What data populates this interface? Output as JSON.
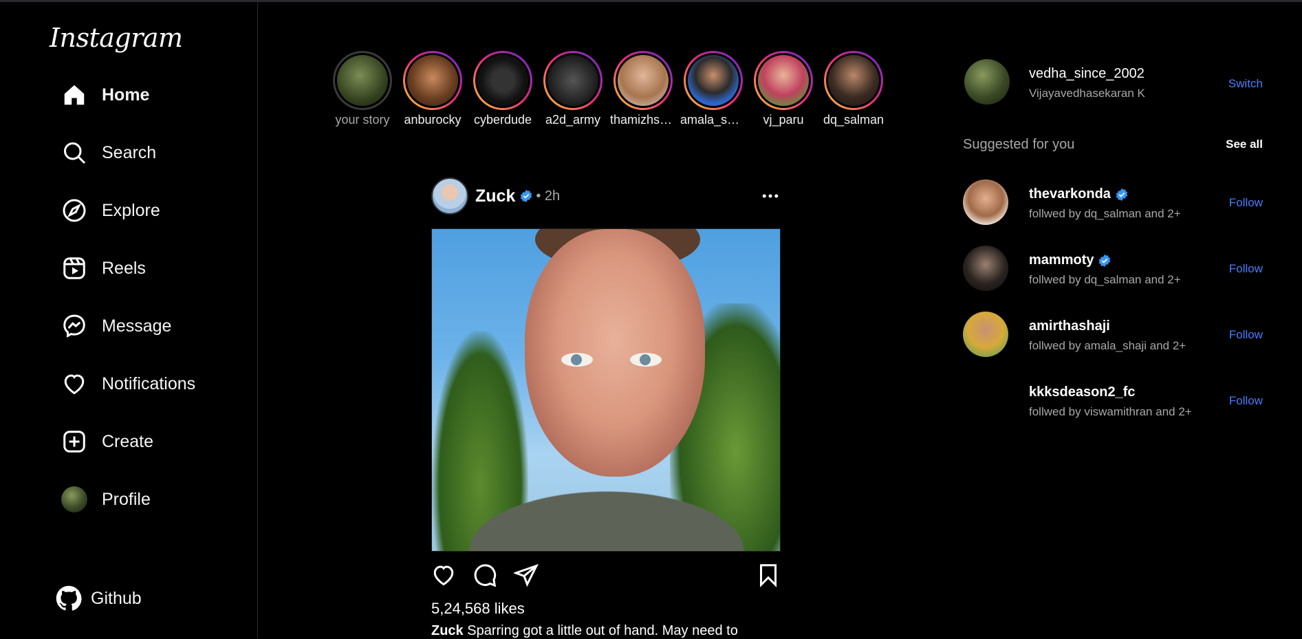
{
  "sidebar": {
    "logo": "Instagram",
    "items": [
      {
        "label": "Home"
      },
      {
        "label": "Search"
      },
      {
        "label": "Explore"
      },
      {
        "label": "Reels"
      },
      {
        "label": "Message"
      },
      {
        "label": "Notifications"
      },
      {
        "label": "Create"
      },
      {
        "label": "Profile"
      }
    ],
    "github": "Github"
  },
  "stories": [
    {
      "name": "your story"
    },
    {
      "name": "anburocky"
    },
    {
      "name": "cyberdude"
    },
    {
      "name": "a2d_army"
    },
    {
      "name": "thamizhsel..."
    },
    {
      "name": "amala_shaji"
    },
    {
      "name": "vj_paru"
    },
    {
      "name": "dq_salman"
    }
  ],
  "post": {
    "user": "Zuck",
    "time": "• 2h",
    "likes": "5,24,568 likes",
    "caption_user": "Zuck",
    "caption_text": "Sparring got a little out of hand. May need to"
  },
  "account": {
    "username": "vedha_since_2002",
    "name": "Vijayavedhasekaran K",
    "switch": "Switch"
  },
  "suggestions": {
    "title": "Suggested for you",
    "see_all": "See all",
    "follow_label": "Follow",
    "items": [
      {
        "user": "thevarkonda",
        "followed": "follwed by dq_salman and 2+",
        "verified": true
      },
      {
        "user": "mammoty",
        "followed": "follwed by dq_salman and 2+",
        "verified": true
      },
      {
        "user": "amirthashaji",
        "followed": "follwed by amala_shaji and 2+",
        "verified": false
      },
      {
        "user": "kkksdeason2_fc",
        "followed": "follwed by viswamithran and 2+",
        "verified": false
      }
    ]
  },
  "colors": {
    "accent": "#4a7dff",
    "verified": "#3897f0",
    "muted": "#a8a8a8"
  }
}
